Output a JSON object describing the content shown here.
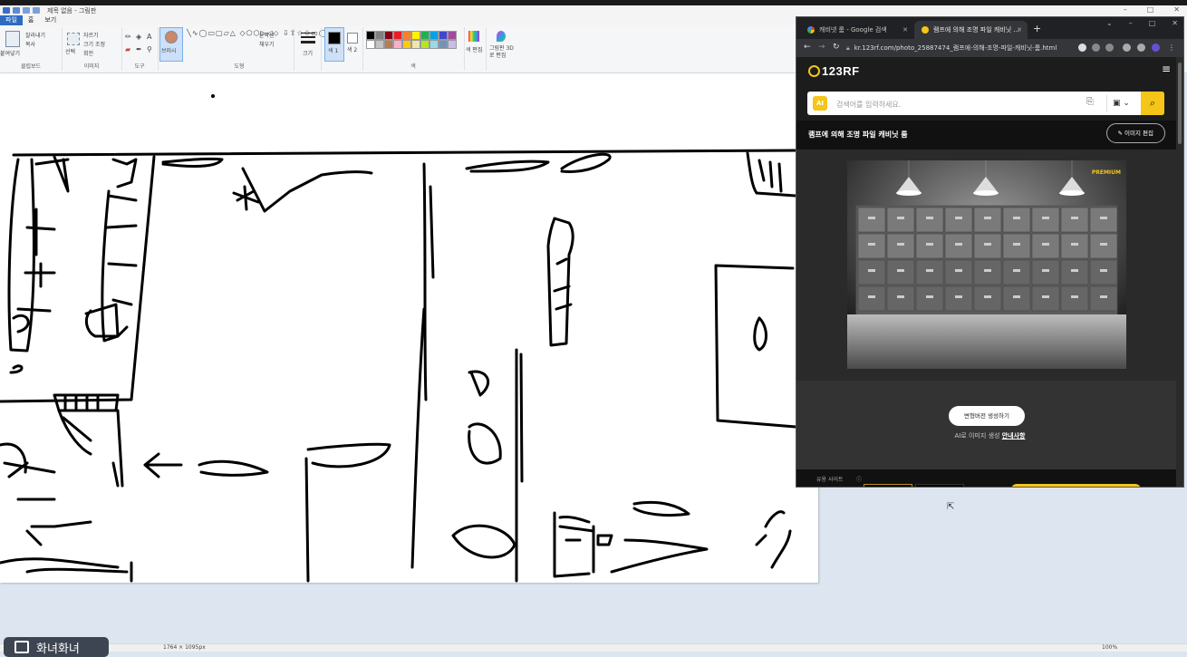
{
  "paint": {
    "title": "제목 없음 - 그림판",
    "tabs": [
      "파일",
      "홈",
      "보기"
    ],
    "clipboard": {
      "paste": "붙여넣기",
      "cut": "잘라내기",
      "copy": "복사",
      "label": "클립보드"
    },
    "image": {
      "select": "선택",
      "crop": "자르기",
      "resize": "크기 조정",
      "rotate": "회전",
      "label": "이미지"
    },
    "tools_label": "도구",
    "brush_label": "브러시",
    "shapes": {
      "outline": "윤곽선",
      "fill": "채우기",
      "label": "도형"
    },
    "size_label": "크기",
    "color1": "색 1",
    "color2": "색 2",
    "edit_colors": "색 편집",
    "paint3d": "그림판 3D로 편집",
    "colors_label": "색",
    "palette": [
      "#000000",
      "#7f7f7f",
      "#880015",
      "#ed1c24",
      "#ff7f27",
      "#fff200",
      "#22b14c",
      "#00a2e8",
      "#3f48cc",
      "#a349a4",
      "#ffffff",
      "#c3c3c3",
      "#b97a57",
      "#ffaec9",
      "#ffc90e",
      "#efe4b0",
      "#b5e61d",
      "#99d9ea",
      "#7092be",
      "#c8bfe7"
    ],
    "status_dims": "1764 × 1095px",
    "zoom": "100%"
  },
  "taskbar": {
    "button_label": "화녀화녀"
  },
  "chrome": {
    "tab1": "캐비넷 룸 - Google 검색",
    "tab2": "램프에 의해 조명 파일 캐비닛 ...",
    "url": "kr.123rf.com/photo_25887474_램프에-의해-조명-파일-캐비닛-룸.html",
    "logo": "123RF",
    "search": {
      "badge": "AI",
      "placeholder": "검색어를 입력하세요."
    },
    "image_title": "램프에 의해 조명 파일 캐비닛 룸",
    "edit_button": "이미지 편집",
    "premium": "PREMIUM",
    "generate_button": "변형버전 생성하기",
    "ai_note": "AI로 이미지 생성",
    "ai_note_link": "안내사항",
    "related_label": "유용 사이트",
    "accent": "#f5c518"
  }
}
